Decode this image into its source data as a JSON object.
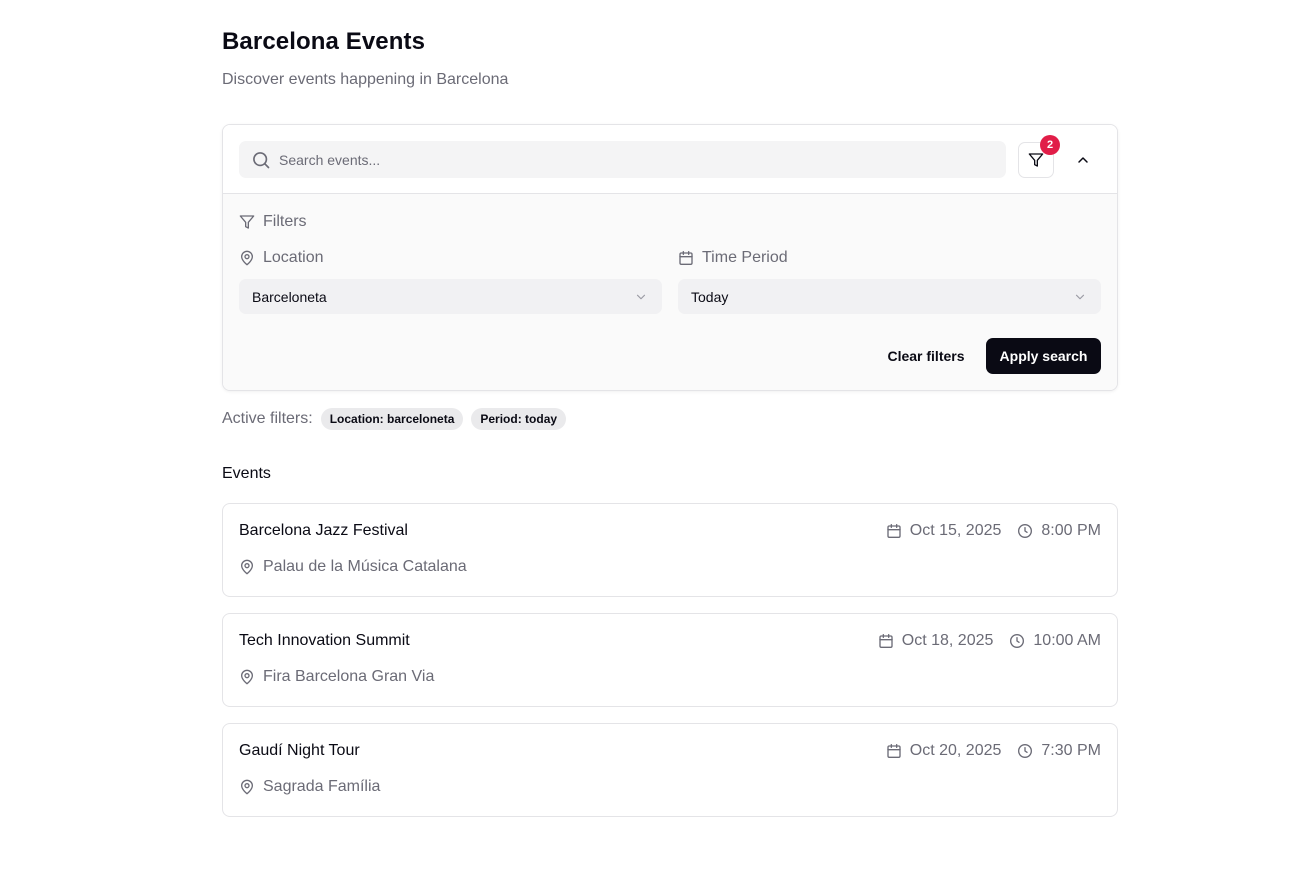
{
  "header": {
    "title": "Barcelona Events",
    "subtitle": "Discover events happening in Barcelona"
  },
  "search": {
    "placeholder": "Search events...",
    "value": "",
    "filter_badge_count": "2"
  },
  "filters": {
    "heading": "Filters",
    "location": {
      "label": "Location",
      "selected": "Barceloneta"
    },
    "time_period": {
      "label": "Time Period",
      "selected": "Today"
    },
    "clear_label": "Clear filters",
    "apply_label": "Apply search"
  },
  "active_filters": {
    "label": "Active filters:",
    "chips": [
      "Location: barceloneta",
      "Period: today"
    ]
  },
  "events": {
    "heading": "Events",
    "items": [
      {
        "title": "Barcelona Jazz Festival",
        "date": "Oct 15, 2025",
        "time": "8:00 PM",
        "venue": "Palau de la Música Catalana"
      },
      {
        "title": "Tech Innovation Summit",
        "date": "Oct 18, 2025",
        "time": "10:00 AM",
        "venue": "Fira Barcelona Gran Via"
      },
      {
        "title": "Gaudí Night Tour",
        "date": "Oct 20, 2025",
        "time": "7:30 PM",
        "venue": "Sagrada Família"
      }
    ]
  },
  "icons": {
    "search": "search-icon",
    "filter": "filter-icon",
    "collapse": "chevron-up-icon",
    "location": "map-pin-icon",
    "calendar": "calendar-icon",
    "clock": "clock-icon",
    "dropdown": "chevron-down-icon"
  },
  "colors": {
    "primary": "#0a0a14",
    "muted": "#6b6b76",
    "badge": "#e11d48",
    "border": "#e4e4e7"
  }
}
